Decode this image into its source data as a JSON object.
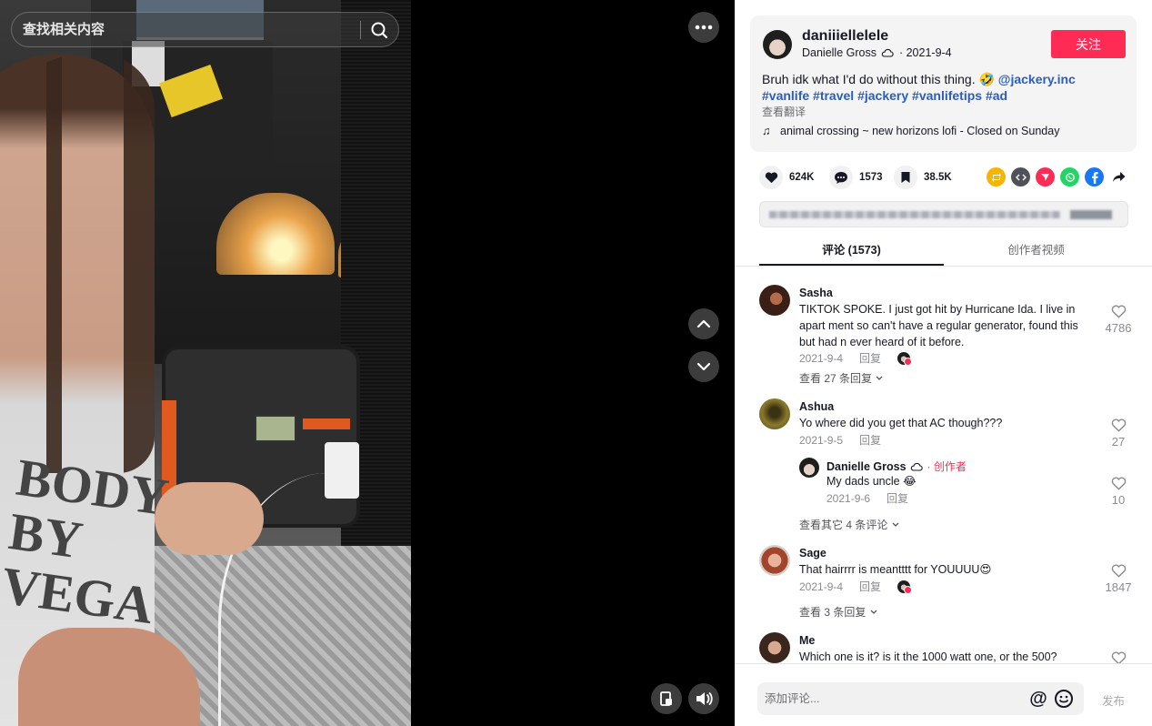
{
  "search": {
    "placeholder": "查找相关内容"
  },
  "video": {
    "shirt_text": "BODY BY VEGA"
  },
  "author": {
    "handle": "daniiiellelele",
    "display_name": "Danielle Gross",
    "date": "2021-9-4",
    "follow_label": "关注"
  },
  "post": {
    "caption_text": "Bruh idk what I'd do without this thing. 🤣 ",
    "mention": "@jackery.inc",
    "hashtags": [
      "#vanlife",
      "#travel",
      "#jackery",
      "#vanlifetips",
      "#ad"
    ],
    "translate_label": "查看翻译",
    "music": "animal crossing ~ new horizons lofi - Closed on Sunday"
  },
  "stats": {
    "likes": "624K",
    "comments": "1573",
    "saves": "38.5K"
  },
  "share_colors": {
    "repost": "#f7b500",
    "embed": "#4f525a",
    "send": "#fe2c55",
    "whatsapp": "#25d366",
    "facebook": "#1877f2"
  },
  "tabs": {
    "comments": "评论 (1573)",
    "creator_videos": "创作者视频"
  },
  "comments": [
    {
      "name": "Sasha",
      "text": "TIKTOK SPOKE. I just got hit by Hurricane Ida. I live in apart ment so can't have a regular generator, found this but had n ever heard of it before.",
      "date": "2021-9-4",
      "reply_label": "回复",
      "likes": "4786",
      "view_replies": "查看 27 条回复"
    },
    {
      "name": "Ashua",
      "text": "Yo where did you get that AC though???",
      "date": "2021-9-5",
      "reply_label": "回复",
      "likes": "27",
      "reply": {
        "name": "Danielle Gross",
        "creator_tag": "· 创作者",
        "text": "My dads uncle 😂",
        "date": "2021-9-6",
        "reply_label": "回复",
        "likes": "10"
      },
      "view_replies": "查看其它 4 条评论"
    },
    {
      "name": "Sage",
      "text": "That hairrrr is meantttt for YOUUUU😍",
      "date": "2021-9-4",
      "reply_label": "回复",
      "likes": "1847",
      "view_replies": "查看 3 条回复"
    },
    {
      "name": "Me",
      "text": "Which one is it? is it the 1000 watt one, or the 500?",
      "date": "",
      "reply_label": "",
      "likes": ""
    }
  ],
  "composer": {
    "placeholder": "添加评论...",
    "at_symbol": "@",
    "post_label": "发布"
  }
}
